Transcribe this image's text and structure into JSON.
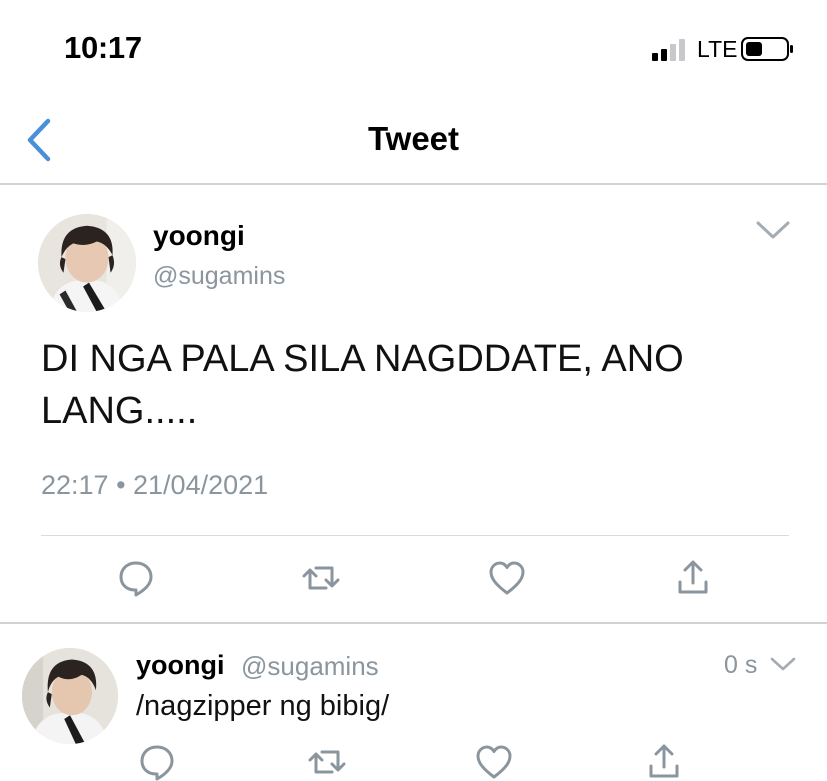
{
  "status_bar": {
    "time": "10:17",
    "network": "LTE",
    "icons": [
      "signal-icon",
      "battery-icon"
    ]
  },
  "nav": {
    "title": "Tweet",
    "back_icon": "chevron-left-icon"
  },
  "tweet": {
    "author_name": "yoongi",
    "author_handle": "@sugamins",
    "text": "DI NGA PALA SILA NAGDDATE, ANO LANG.....",
    "timestamp": "22:17 • 21/04/2021",
    "actions": [
      "reply-icon",
      "retweet-icon",
      "like-icon",
      "share-icon"
    ]
  },
  "reply": {
    "author_name": "yoongi",
    "author_handle": "@sugamins",
    "time_ago": "0 s",
    "text": "/nagzipper ng bibig/"
  },
  "colors": {
    "accent": "#4a90d9",
    "secondary_text": "#8a959e",
    "icon_gray": "#8a959e",
    "divider": "#cfd3d6"
  }
}
